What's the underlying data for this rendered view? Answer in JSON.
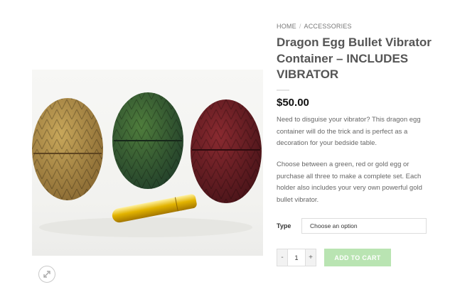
{
  "breadcrumb": {
    "home": "HOME",
    "separator": "/",
    "category": "ACCESSORIES"
  },
  "product": {
    "title": "Dragon Egg Bullet Vibrator Container – INCLUDES VIBRATOR",
    "price": "$50.00",
    "description_1": "Need to disguise your vibrator? This dragon egg container will do the trick and is perfect as a decoration for your bedside table.",
    "description_2": "Choose between a green, red or gold egg or purchase all three to make a complete set. Each holder also includes your very own powerful gold bullet vibrator."
  },
  "variation": {
    "label": "Type",
    "placeholder": "Choose an option"
  },
  "quantity": {
    "minus": "-",
    "value": "1",
    "plus": "+"
  },
  "cart": {
    "button_label": "ADD TO CART"
  },
  "gallery": {
    "zoom_icon": "zoom-expand-icon"
  },
  "colors": {
    "accent_button": "#b9e4b2",
    "price": "#111111",
    "title": "#555555"
  }
}
